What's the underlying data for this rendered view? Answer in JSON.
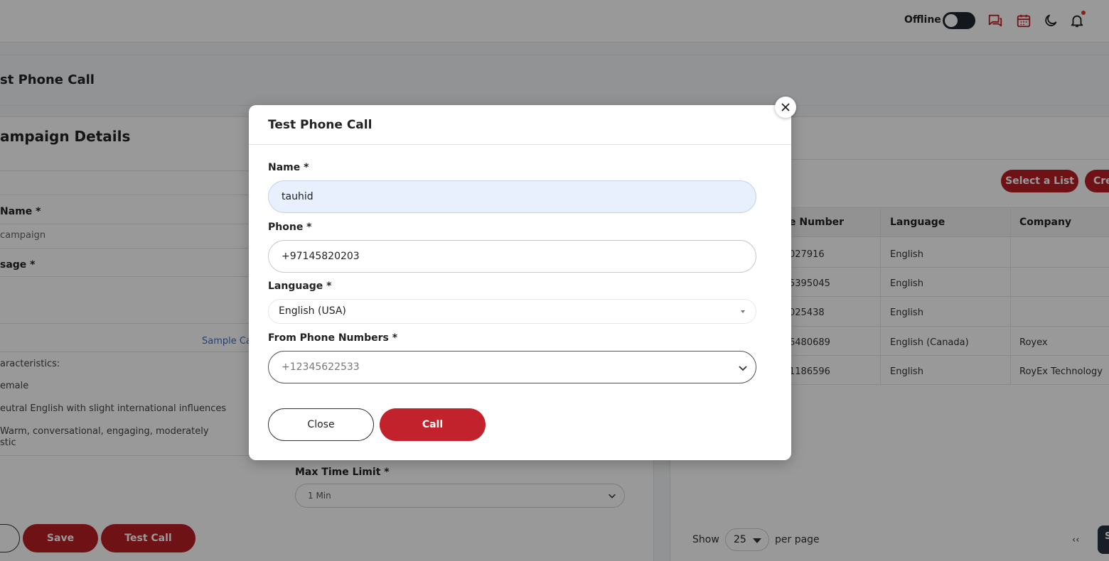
{
  "topbar": {
    "status_label": "Offline"
  },
  "background": {
    "page_title": "st Phone Call",
    "section_title": "ampaign Details",
    "name_label": " Name *",
    "name_value": "campaign",
    "message_label": "sage *",
    "sample_link": "Sample Ca",
    "characteristics_label": "aracteristics:",
    "gender_value": "emale",
    "accent_value": "eutral English with slight international influences",
    "tone_value_line1": "Warm, conversational, engaging, moderately",
    "tone_value_line2": "stic",
    "max_time_label": "Max Time Limit *",
    "max_time_value": "1 Min",
    "save_label": "Save",
    "test_call_label": "Test Call",
    "select_list_label": "Select a List",
    "create_label": "Cre",
    "table": {
      "headers": [
        "e Number",
        "Language",
        "Company"
      ],
      "rows": [
        [
          "027916",
          "English",
          ""
        ],
        [
          "5395045",
          "English",
          ""
        ],
        [
          "025438",
          "English",
          ""
        ],
        [
          "6480689",
          "English (Canada)",
          "Royex"
        ],
        [
          "1186596",
          "English",
          "RoyEx Technology"
        ]
      ]
    },
    "show_label": "Show",
    "per_page_value": "25",
    "per_page_label": "per page",
    "prev_label": "‹‹",
    "chip_label": "S"
  },
  "modal": {
    "title": "Test Phone Call",
    "name_label": "Name *",
    "name_value": "tauhid",
    "phone_label": "Phone *",
    "phone_value": "+97145820203",
    "language_label": "Language *",
    "language_value": "English (USA)",
    "from_label": "From Phone Numbers *",
    "from_value": "+12345622533",
    "close_label": "Close",
    "call_label": "Call"
  },
  "colors": {
    "brand_red": "#c2222b",
    "overlay": "rgba(0,0,0,0.40)"
  }
}
